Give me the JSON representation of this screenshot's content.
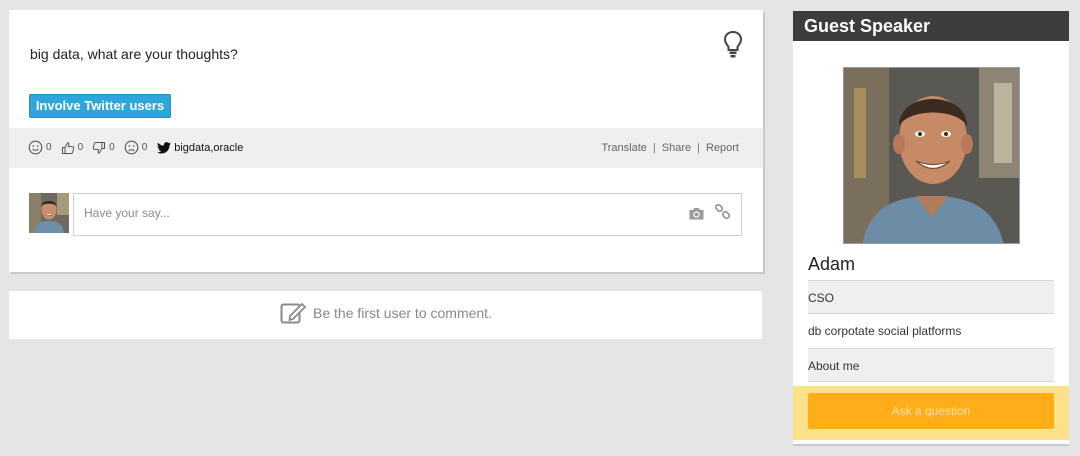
{
  "post": {
    "text": "big data, what are your thoughts?",
    "twitter_button": "Involve Twitter users",
    "reactions": {
      "smile": "0",
      "like": "0",
      "dislike": "0",
      "sad": "0"
    },
    "tags": "bigdata,oracle",
    "links": {
      "translate": "Translate",
      "share": "Share",
      "report": "Report"
    },
    "comment_placeholder": "Have your say..."
  },
  "comments": {
    "empty_text": "Be the first user to comment."
  },
  "speaker": {
    "header": "Guest Speaker",
    "name": "Adam",
    "title": "CSO",
    "company": "db corpotate social platforms",
    "about": "About me",
    "ask_button": "Ask a question"
  },
  "colors": {
    "twitter": "#2ea6dc",
    "header": "#3d3d3d",
    "ask": "#ffae1a",
    "ask_bg": "#fde08a"
  }
}
